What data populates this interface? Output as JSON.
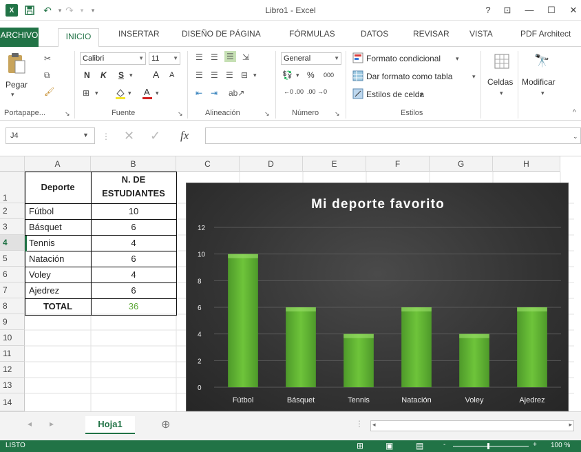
{
  "window": {
    "title": "Libro1 - Excel",
    "controls": {
      "help": "?",
      "restore_ribbon": "⊡",
      "minimize": "—",
      "maximize": "☐",
      "close": "✕"
    }
  },
  "quick_access": {
    "undo": "↶",
    "redo": "↷",
    "customize": "▾"
  },
  "tabs": [
    "ARCHIVO",
    "INICIO",
    "INSERTAR",
    "DISEÑO DE PÁGINA",
    "FÓRMULAS",
    "DATOS",
    "REVISAR",
    "VISTA",
    "PDF Architect"
  ],
  "ribbon": {
    "clipboard": {
      "paste_label": "Pegar",
      "group_label": "Portapape..."
    },
    "font": {
      "font_name": "Calibri",
      "font_size": "11",
      "bold": "N",
      "italic": "K",
      "underline": "S",
      "grow": "A",
      "shrink": "A",
      "group_label": "Fuente"
    },
    "alignment": {
      "group_label": "Alineación"
    },
    "number": {
      "format": "General",
      "percent": "%",
      "thousands": "000",
      "inc_dec": "←0 .00",
      "dec_dec": ".00 →0",
      "group_label": "Número"
    },
    "styles": {
      "conditional": "Formato condicional",
      "as_table": "Dar formato como tabla",
      "cell_styles": "Estilos de celda",
      "group_label": "Estilos"
    },
    "cells": {
      "label": "Celdas"
    },
    "editing": {
      "label": "Modificar"
    }
  },
  "formula_bar": {
    "name_box": "J4",
    "fx": "fx",
    "value": ""
  },
  "columns": [
    "A",
    "B",
    "C",
    "D",
    "E",
    "F",
    "G",
    "H"
  ],
  "rows": [
    "1",
    "2",
    "3",
    "4",
    "5",
    "6",
    "7",
    "8",
    "9",
    "10",
    "11",
    "12",
    "13",
    "14"
  ],
  "table": {
    "header_a": "Deporte",
    "header_b_line1": "N. DE",
    "header_b_line2": "ESTUDIANTES",
    "data": [
      {
        "sport": "Fútbol",
        "count": "10"
      },
      {
        "sport": "Básquet",
        "count": "6"
      },
      {
        "sport": "Tennis",
        "count": "4"
      },
      {
        "sport": "Natación",
        "count": "6"
      },
      {
        "sport": "Voley",
        "count": "4"
      },
      {
        "sport": "Ajedrez",
        "count": "6"
      }
    ],
    "total_label": "TOTAL",
    "total_value": "36"
  },
  "chart_data": {
    "type": "bar",
    "title": "Mi deporte favorito",
    "categories": [
      "Fútbol",
      "Básquet",
      "Tennis",
      "Natación",
      "Voley",
      "Ajedrez"
    ],
    "values": [
      10,
      6,
      4,
      6,
      4,
      6
    ],
    "ylim": [
      0,
      12
    ],
    "yticks": [
      "0",
      "2",
      "4",
      "6",
      "8",
      "10",
      "12"
    ],
    "xlabel": "",
    "ylabel": "",
    "grid": true,
    "bar_color": "#6ec43a"
  },
  "sheets": {
    "active": "Hoja1",
    "add": "⊕"
  },
  "status": {
    "mode": "LISTO",
    "zoom": "100 %",
    "zoom_minus": "-",
    "zoom_plus": "+"
  },
  "colors": {
    "accent": "#217346",
    "total_value": "#5fa83a"
  }
}
